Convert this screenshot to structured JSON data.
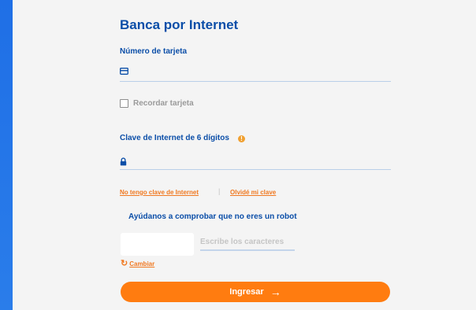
{
  "title": "Banca por Internet",
  "card": {
    "label": "Número de tarjeta",
    "icon": "credit-card-icon",
    "value": ""
  },
  "remember": {
    "label": "Recordar tarjeta",
    "checked": false
  },
  "password": {
    "label": "Clave de Internet de 6 dígitos",
    "info_icon": "info-icon",
    "info_glyph": "!",
    "lock_icon": "lock-icon",
    "value": ""
  },
  "links": {
    "no_key": "No tengo clave de Internet",
    "separator": "|",
    "forgot": "Olvidé mi clave"
  },
  "captcha": {
    "title": "Ayúdanos a comprobar que no eres un robot",
    "placeholder": "Escribe los caracteres",
    "refresh_glyph": "↻",
    "refresh_label": "Cambiar"
  },
  "submit": {
    "label": "Ingresar",
    "arrow": "→"
  },
  "colors": {
    "brand_blue": "#0b4ea8",
    "accent_orange": "#ff7c10",
    "side_band": "#1f6fe6"
  }
}
